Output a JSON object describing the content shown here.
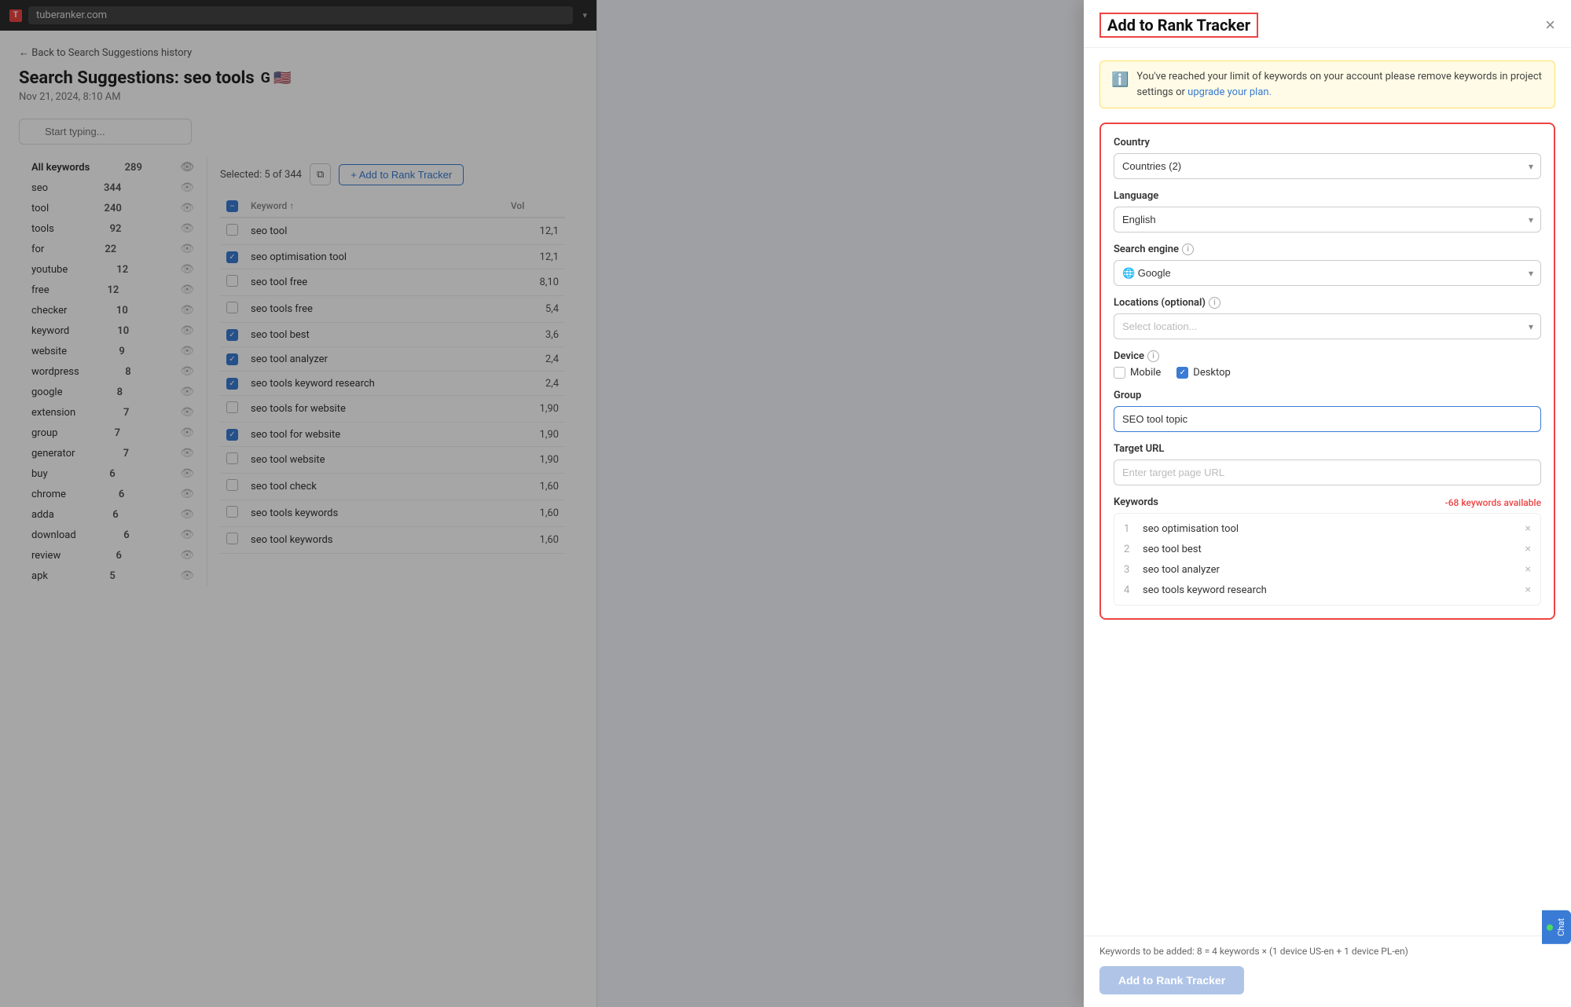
{
  "browser": {
    "url": "tuberanker.com",
    "chevron": "▾"
  },
  "page": {
    "back_link": "← Back to Search Suggestions history",
    "title": "Search Suggestions: seo tools",
    "subtitle": "Nov 21, 2024, 8:10 AM",
    "search_placeholder": "Start typing..."
  },
  "keywords_sidebar": {
    "items": [
      {
        "label": "All keywords",
        "count": 289,
        "active": true
      },
      {
        "label": "seo",
        "count": 344
      },
      {
        "label": "tool",
        "count": 240
      },
      {
        "label": "tools",
        "count": 92
      },
      {
        "label": "for",
        "count": 22
      },
      {
        "label": "youtube",
        "count": 12
      },
      {
        "label": "free",
        "count": 12
      },
      {
        "label": "checker",
        "count": 10
      },
      {
        "label": "keyword",
        "count": 10
      },
      {
        "label": "website",
        "count": 9
      },
      {
        "label": "wordpress",
        "count": 8
      },
      {
        "label": "google",
        "count": 8
      },
      {
        "label": "extension",
        "count": 7
      },
      {
        "label": "group",
        "count": 7
      },
      {
        "label": "generator",
        "count": 7
      },
      {
        "label": "buy",
        "count": 6
      },
      {
        "label": "chrome",
        "count": 6
      },
      {
        "label": "adda",
        "count": 6
      },
      {
        "label": "download",
        "count": 6
      },
      {
        "label": "review",
        "count": 6
      },
      {
        "label": "apk",
        "count": 5
      }
    ]
  },
  "table": {
    "toolbar": {
      "selected_label": "Selected: 5 of 344",
      "copy_icon": "⧉",
      "add_btn": "+ Add to Rank Tracker"
    },
    "columns": [
      "Keyword",
      "Vol"
    ],
    "rows": [
      {
        "keyword": "seo tool",
        "volume": "12,1",
        "checked": false
      },
      {
        "keyword": "seo optimisation tool",
        "volume": "12,1",
        "checked": true
      },
      {
        "keyword": "seo tool free",
        "volume": "8,10",
        "checked": false
      },
      {
        "keyword": "seo tools free",
        "volume": "5,4",
        "checked": false
      },
      {
        "keyword": "seo tool best",
        "volume": "3,6",
        "checked": true
      },
      {
        "keyword": "seo tool analyzer",
        "volume": "2,4",
        "checked": true
      },
      {
        "keyword": "seo tools keyword research",
        "volume": "2,4",
        "checked": true
      },
      {
        "keyword": "seo tools for website",
        "volume": "1,90",
        "checked": false
      },
      {
        "keyword": "seo tool for website",
        "volume": "1,90",
        "checked": true
      },
      {
        "keyword": "seo tool website",
        "volume": "1,90",
        "checked": false
      },
      {
        "keyword": "seo tool check",
        "volume": "1,60",
        "checked": false
      },
      {
        "keyword": "seo tools keywords",
        "volume": "1,60",
        "checked": false
      },
      {
        "keyword": "seo tool keywords",
        "volume": "1,60",
        "checked": false
      }
    ]
  },
  "modal": {
    "title": "Add to Rank Tracker",
    "close_icon": "×",
    "warning_text": "You've reached your limit of keywords on your account please remove keywords in project settings or",
    "upgrade_link_text": "upgrade your plan.",
    "form": {
      "country_label": "Country",
      "country_value": "Countries (2)",
      "language_label": "Language",
      "language_value": "English",
      "search_engine_label": "Search engine",
      "search_engine_value": "Google",
      "locations_label": "Locations (optional)",
      "locations_placeholder": "Select location...",
      "device_label": "Device",
      "device_mobile": "Mobile",
      "device_mobile_checked": false,
      "device_desktop": "Desktop",
      "device_desktop_checked": true,
      "group_label": "Group",
      "group_value": "SEO tool topic",
      "target_url_label": "Target URL",
      "target_url_placeholder": "Enter target page URL",
      "keywords_label": "Keywords",
      "keywords_available": "-68 keywords available",
      "keywords": [
        {
          "num": 1,
          "name": "seo optimisation tool"
        },
        {
          "num": 2,
          "name": "seo tool best"
        },
        {
          "num": 3,
          "name": "seo tool analyzer"
        },
        {
          "num": 4,
          "name": "seo tools keyword research"
        }
      ]
    },
    "footer": {
      "note": "Keywords to be added: 8 = 4 keywords × (1 device US-en + 1 device PL-en)",
      "add_btn": "Add to Rank Tracker"
    }
  },
  "chat": {
    "label": "Chat"
  }
}
